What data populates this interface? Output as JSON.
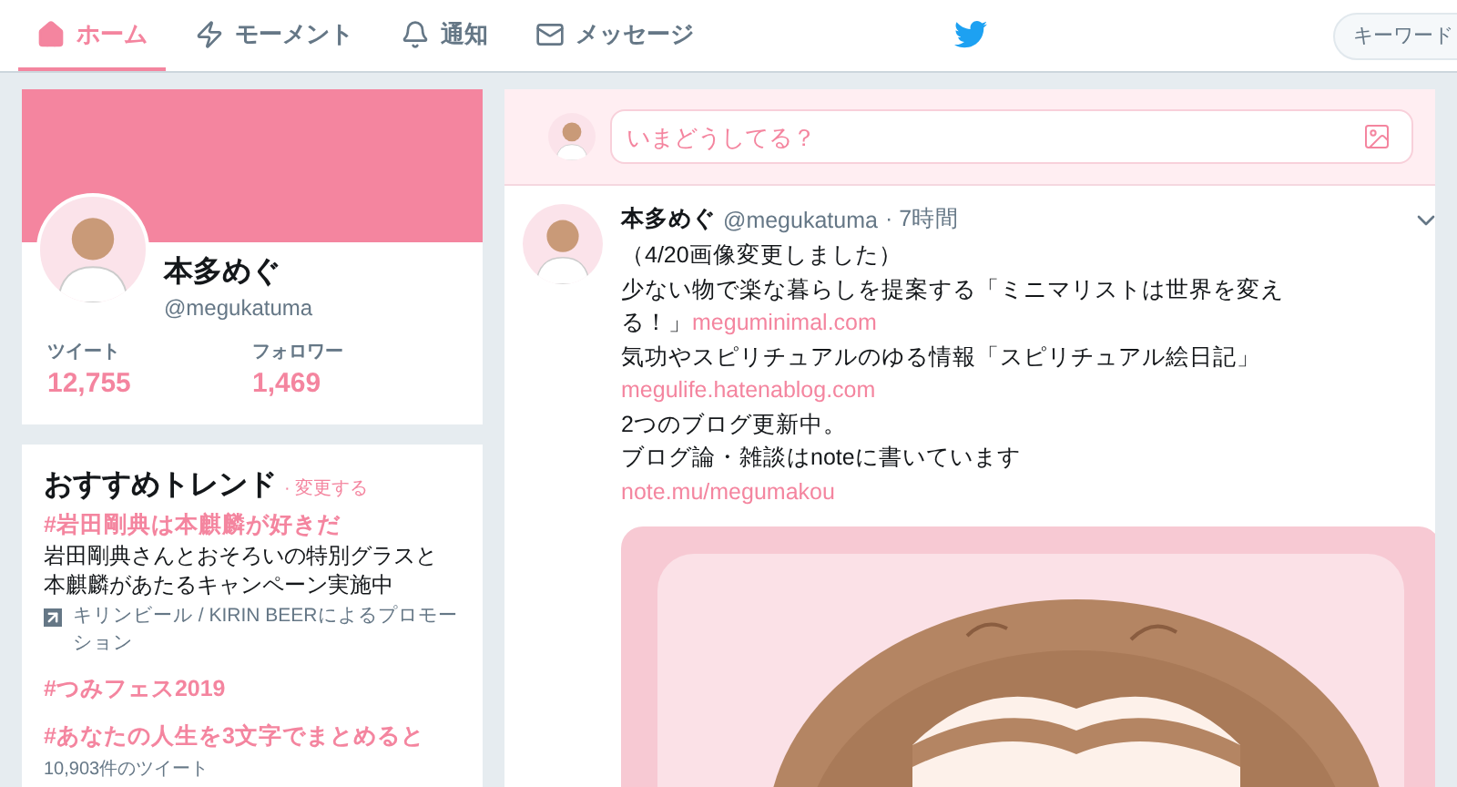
{
  "nav": {
    "tabs": [
      {
        "label": "ホーム",
        "selected": true
      },
      {
        "label": "モーメント",
        "selected": false
      },
      {
        "label": "通知",
        "selected": false
      },
      {
        "label": "メッセージ",
        "selected": false
      }
    ],
    "search": {
      "placeholder": "キーワード"
    }
  },
  "profile": {
    "name": "本多めぐ",
    "handle": "@megukatuma",
    "stats": [
      {
        "label": "ツイート",
        "value": "12,755"
      },
      {
        "label": "フォロワー",
        "value": "1,469"
      }
    ]
  },
  "trends": {
    "title": "おすすめトレンド",
    "change": "· 変更する",
    "items": [
      {
        "hashtag": "#岩田剛典は本麒麟が好きだ",
        "description": "岩田剛典さんとおそろいの特別グラスと本麒麟があたるキャンペーン実施中",
        "promoted": "キリンビール / KIRIN BEERによるプロモーション"
      },
      {
        "hashtag": "#つみフェス2019"
      },
      {
        "hashtag": "#あなたの人生を3文字でまとめると",
        "count": "10,903件のツイート"
      }
    ]
  },
  "compose": {
    "placeholder": "いまどうしてる？"
  },
  "tweet": {
    "name": "本多めぐ",
    "handle": "@megukatuma",
    "time": "· 7時間",
    "lines": [
      [
        {
          "kind": "text",
          "text": "（4/20画像変更しました）"
        }
      ],
      [
        {
          "kind": "text",
          "text": "少ない物で楽な暮らしを提案する「ミニマリストは世界を変える！」"
        },
        {
          "kind": "link",
          "text": "meguminimal.com"
        }
      ],
      [
        {
          "kind": "text",
          "text": "気功やスピリチュアルのゆる情報「スピリチュアル絵日記」"
        }
      ],
      [
        {
          "kind": "link",
          "text": "megulife.hatenablog.com"
        }
      ],
      [
        {
          "kind": "text",
          "text": "2つのブログ更新中。"
        }
      ],
      [
        {
          "kind": "text",
          "text": "ブログ論・雑談はnoteに書いています"
        }
      ],
      [
        {
          "kind": "link",
          "text": "note.mu/megumakou"
        }
      ]
    ],
    "media": {
      "kind": "picture"
    }
  }
}
